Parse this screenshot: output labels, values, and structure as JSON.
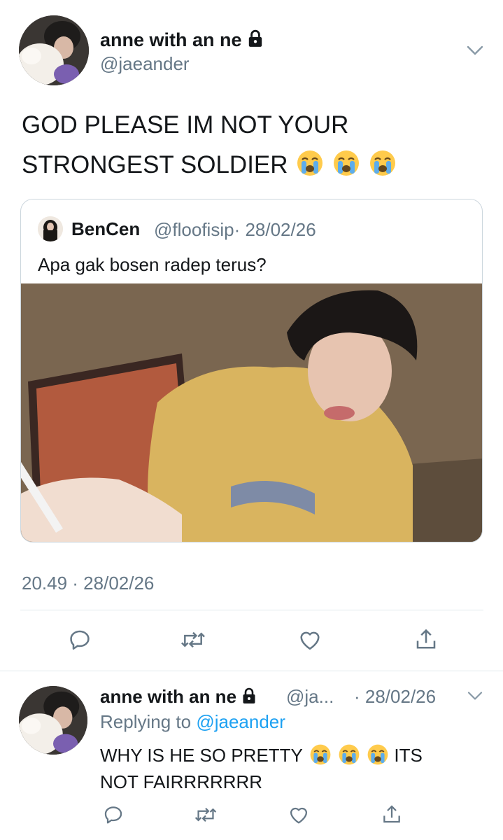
{
  "main_tweet": {
    "display_name": "anne with an ne",
    "handle": "@jaeander",
    "text_line1": "GOD PLEASE IM NOT YOUR",
    "text_line2": "STRONGEST SOLDIER",
    "emoji_icon": "loudly-crying-face-icon",
    "timestamp": "20.49 · 28/02/26"
  },
  "quoted_tweet": {
    "display_name": "BenCen",
    "handle": "@floofisip",
    "date": "· 28/02/26",
    "text": "Apa gak bosen radep terus?"
  },
  "actions": [
    "reply-icon",
    "retweet-icon",
    "like-icon",
    "share-icon"
  ],
  "reply_tweet": {
    "display_name": "anne with an ne",
    "handle": "@ja...",
    "date": "· 28/02/26",
    "replying_prefix": "Replying to",
    "replying_to": "@jaeander",
    "text_part1": "WHY IS HE SO PRETTY",
    "text_part2": "ITS",
    "text_line2": "NOT FAIRRRRRRR"
  },
  "colors": {
    "text": "#14171a",
    "secondary": "#657786",
    "link": "#1da1f2",
    "border": "#ccd6dd",
    "icon": "#657786"
  }
}
